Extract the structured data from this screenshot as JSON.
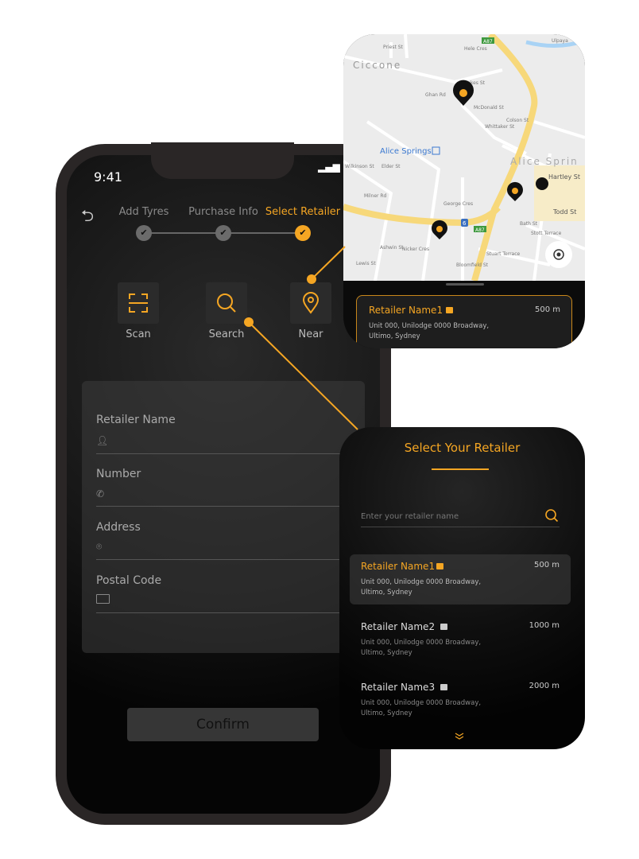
{
  "phone": {
    "status_time": "9:41",
    "steps": [
      {
        "label": "Add Tyres",
        "done": true
      },
      {
        "label": "Purchase Info",
        "done": true
      },
      {
        "label": "Select Retailer",
        "done": true,
        "active": true
      }
    ],
    "options": [
      {
        "label": "Scan",
        "icon": "scan-icon"
      },
      {
        "label": "Search",
        "icon": "search-icon"
      },
      {
        "label": "Near",
        "icon": "location-pin-icon"
      }
    ],
    "form": {
      "fields": [
        {
          "label": "Retailer Name",
          "icon": "person-icon"
        },
        {
          "label": "Number",
          "icon": "phone-icon"
        },
        {
          "label": "Address",
          "icon": "location-pin-icon"
        },
        {
          "label": "Postal Code",
          "icon": "postal-card-icon"
        }
      ]
    },
    "confirm_label": "Confirm"
  },
  "map": {
    "labels": {
      "area1": "Ciccone",
      "station": "Alice Springs",
      "area2": "Alice Sprin",
      "road1": "A87",
      "road2": "A87",
      "route": "6",
      "streets": [
        "Priest St",
        "Hele Cres",
        "Stokes St",
        "Ghan Rd",
        "McDonald St",
        "Colson St",
        "Whittaker St",
        "Wilkinson St",
        "Elder St",
        "Milner Rd",
        "George Cres",
        "Bath St",
        "Hartley St",
        "Stott Terrace",
        "Stuart Terrace",
        "Todd St",
        "Lewis St",
        "Ashwin St",
        "Nicker Cres",
        "Bloomfield St",
        "Ulpaya"
      ]
    },
    "selected": {
      "name": "Retailer Name1",
      "distance": "500 m",
      "address_line1": "Unit 000, Unilodge 0000 Broadway,",
      "address_line2": "Ultimo, Sydney"
    }
  },
  "retailer_list": {
    "title": "Select Your Retailer",
    "search_placeholder": "Enter your retailer name",
    "items": [
      {
        "name": "Retailer Name1",
        "distance": "500 m",
        "address_line1": "Unit 000, Unilodge 0000 Broadway,",
        "address_line2": "Ultimo, Sydney",
        "selected": true
      },
      {
        "name": "Retailer Name2",
        "distance": "1000 m",
        "address_line1": "Unit 000, Unilodge 0000 Broadway,",
        "address_line2": "Ultimo, Sydney"
      },
      {
        "name": "Retailer Name3",
        "distance": "2000 m",
        "address_line1": "Unit 000, Unilodge 0000 Broadway,",
        "address_line2": "Ultimo, Sydney"
      }
    ]
  },
  "colors": {
    "accent": "#f5a623",
    "background": "#0b0b0b",
    "panel": "#2b2b2b"
  }
}
